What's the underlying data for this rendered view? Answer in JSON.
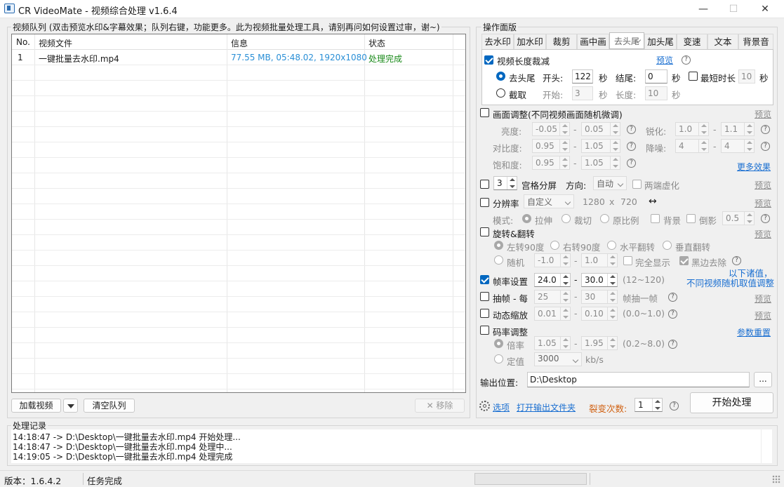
{
  "window": {
    "title": "CR VideoMate - 视频综合处理 v1.6.4",
    "minimize": "—",
    "maximize": "☐",
    "close": "✕"
  },
  "queue": {
    "title": "视频队列 (双击预览水印&字幕效果；队列右键，功能更多。此为视频批量处理工具，请别再问如何设置过审，谢~)",
    "columns": [
      "No.",
      "视频文件",
      "信息",
      "状态"
    ],
    "rows": [
      {
        "no": "1",
        "file": "一键批量去水印.mp4",
        "info": "77.55 MB, 05:48.02, 1920x1080",
        "status": "处理完成"
      }
    ],
    "add_button": "加载视频",
    "clear_button": "清空队列",
    "remove_button": "✕ 移除"
  },
  "ops": {
    "title": "操作面版",
    "tabs": [
      "去水印",
      "加水印",
      "裁剪",
      "画中画",
      "去头尾",
      "加头尾",
      "变速",
      "文本",
      "背景音"
    ],
    "selected_tab": "去头尾",
    "trim": {
      "label": "视频长度裁减",
      "preview": "预览",
      "mode1": "去头尾",
      "head_label": "开头:",
      "head": "122",
      "sec": "秒",
      "tail_label": "结尾:",
      "tail": "0",
      "maxlen_label": "最短时长",
      "maxlen": "10",
      "mode2": "截取",
      "start_label": "开始:",
      "start": "3",
      "len_label": "长度:",
      "len": "10"
    },
    "adjust": {
      "label": "画面调整(不同视频画面随机微调)",
      "preview": "预览",
      "brightness": "亮度:",
      "b1": "-0.05",
      "b2": "0.05",
      "sharpen": "锐化:",
      "s1": "1.0",
      "s2": "1.1",
      "contrast": "对比度:",
      "c1": "0.95",
      "c2": "1.05",
      "denoise": "降噪:",
      "d1": "4",
      "d2": "4",
      "saturation": "饱和度:",
      "sa1": "0.95",
      "sa2": "1.05",
      "more": "更多效果"
    },
    "grid": {
      "count": "3",
      "label": "宫格分屏",
      "dir_label": "方向:",
      "dir": "自动",
      "blur": "两端虚化",
      "preview": "预览"
    },
    "resolution": {
      "label": "分辨率",
      "mode": "自定义",
      "w": "1280",
      "x": "x",
      "h": "720",
      "arrow": "↔",
      "preview": "预览",
      "mode_label": "模式:",
      "stretch": "拉伸",
      "crop": "裁切",
      "keep": "原比例",
      "bg": "背景",
      "reflect": "倒影",
      "reflect_val": "0.5"
    },
    "rotate": {
      "label": "旋转&翻转",
      "preview": "预览",
      "l90": "左转90度",
      "r90": "右转90度",
      "hflip": "水平翻转",
      "vflip": "垂直翻转",
      "random": "随机",
      "r1": "-1.0",
      "r2": "1.0",
      "full": "完全显示",
      "black": "黑边去除"
    },
    "fps": {
      "label": "帧率设置",
      "f1": "24.0",
      "f2": "30.0",
      "range": "(12~120)",
      "note1": "以下诸值，",
      "note2": "不同视频随机取值调整"
    },
    "drop": {
      "label": "抽帧 - 每",
      "d1": "25",
      "d2": "30",
      "suffix": "帧抽一帧",
      "preview": "预览"
    },
    "zoom": {
      "label": "动态缩放",
      "z1": "0.01",
      "z2": "0.10",
      "range": "(0.0~1.0)",
      "preview": "预览"
    },
    "bitrate": {
      "label": "码率调整",
      "link": "参数重置",
      "ratio": "倍率",
      "r1": "1.05",
      "r2": "1.95",
      "range": "(0.2~8.0)",
      "fixed": "定值",
      "fixed_val": "3000",
      "unit": "kb/s"
    },
    "output": {
      "label": "输出位置:",
      "path": "D:\\Desktop",
      "browse": "..."
    },
    "options": "选项",
    "open_folder": "打开输出文件夹",
    "split_label": "裂变次数:",
    "split": "1",
    "start": "开始处理"
  },
  "log": {
    "title": "处理记录",
    "lines": [
      "14:18:47 -> D:\\Desktop\\一键批量去水印.mp4 开始处理...",
      "14:18:47 -> D:\\Desktop\\一键批量去水印.mp4 处理中...",
      "14:19:05 -> D:\\Desktop\\一键批量去水印.mp4 处理完成"
    ]
  },
  "status": {
    "version": "版本：1.6.4.2",
    "message": "任务完成"
  },
  "colors": {
    "accent": "#0067c0",
    "link": "#1a6fd1",
    "done": "#1a8a1a",
    "info": "#2a8fd6",
    "orange": "#d06010"
  }
}
